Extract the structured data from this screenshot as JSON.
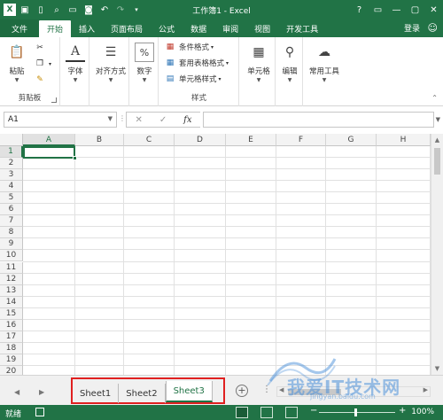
{
  "window": {
    "title": "工作簿1 - Excel"
  },
  "qat": {
    "icons": [
      "excel-logo-icon",
      "save-icon",
      "new-icon",
      "print-preview-icon",
      "open-icon",
      "camera-icon",
      "undo-icon",
      "redo-icon",
      "customize-icon"
    ]
  },
  "win_controls": {
    "help": "?",
    "ribbon_opts": "▭",
    "minimize": "—",
    "maximize": "▢",
    "close": "✕"
  },
  "tabs": {
    "file": "文件",
    "items": [
      "开始",
      "插入",
      "页面布局",
      "公式",
      "数据",
      "审阅",
      "视图",
      "开发工具"
    ],
    "active": "开始"
  },
  "account": {
    "login": "登录",
    "smile": "☺"
  },
  "ribbon": {
    "clipboard": {
      "paste": "粘贴",
      "label": "剪贴板"
    },
    "font": {
      "label": "字体"
    },
    "alignment": {
      "label": "对齐方式"
    },
    "number": {
      "label": "数字"
    },
    "styles": {
      "conditional": "条件格式",
      "table": "套用表格格式",
      "cell_styles": "单元格样式",
      "label": "样式"
    },
    "cells": {
      "label": "单元格"
    },
    "editing": {
      "label": "编辑"
    },
    "tools": {
      "label": "常用工具"
    }
  },
  "formula_bar": {
    "name_box": "A1",
    "cancel": "✕",
    "enter": "✓",
    "fx": "fx",
    "value": ""
  },
  "grid": {
    "columns": [
      "A",
      "B",
      "C",
      "D",
      "E",
      "F",
      "G",
      "H"
    ],
    "rows": [
      "1",
      "2",
      "3",
      "4",
      "5",
      "6",
      "7",
      "8",
      "9",
      "10",
      "11",
      "12",
      "13",
      "14",
      "15",
      "16",
      "17",
      "18",
      "19",
      "20"
    ],
    "active_cell": "A1"
  },
  "sheets": {
    "tabs": [
      "Sheet1",
      "Sheet2",
      "Sheet3"
    ],
    "active": "Sheet3",
    "add": "+"
  },
  "status": {
    "ready": "就绪",
    "zoom": "100%",
    "zoom_minus": "−",
    "zoom_plus": "+"
  },
  "watermark": {
    "text": "我爱IT技术网",
    "url": "jingyan.baidu.com"
  },
  "colors": {
    "accent": "#217346",
    "highlight": "#e02020"
  }
}
